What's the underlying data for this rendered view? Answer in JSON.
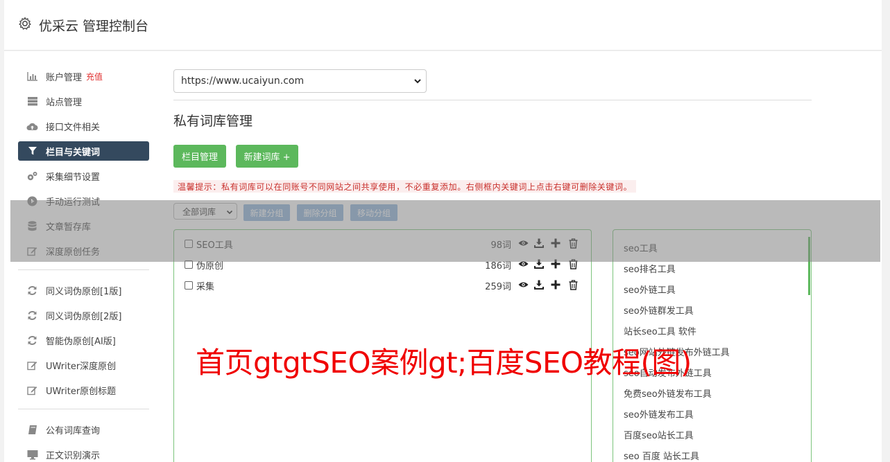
{
  "header": {
    "title": "优采云 管理控制台"
  },
  "sidebar": {
    "items": [
      {
        "label": "账户管理",
        "badge": "充值",
        "icon": "bar-chart-icon"
      },
      {
        "label": "站点管理",
        "icon": "server-icon"
      },
      {
        "label": "接口文件相关",
        "icon": "cloud-upload-icon"
      },
      {
        "label": "栏目与关键词",
        "icon": "filter-icon"
      },
      {
        "label": "采集细节设置",
        "icon": "gears-icon"
      },
      {
        "label": "手动运行测试",
        "icon": "play-circle-icon"
      },
      {
        "label": "文章暂存库",
        "icon": "database-icon"
      },
      {
        "label": "深度原创任务",
        "icon": "edit-icon"
      },
      {
        "label": "同义词伪原创[1版]",
        "icon": "refresh-icon"
      },
      {
        "label": "同义词伪原创[2版]",
        "icon": "refresh-icon"
      },
      {
        "label": "智能伪原创[AI版]",
        "icon": "refresh-icon"
      },
      {
        "label": "UWriter深度原创",
        "icon": "edit-icon"
      },
      {
        "label": "UWriter原创标题",
        "icon": "edit-icon"
      },
      {
        "label": "公有词库查询",
        "icon": "book-icon"
      },
      {
        "label": "正文识别演示",
        "icon": "monitor-icon"
      }
    ],
    "active_index": 3
  },
  "site_select": {
    "value": "https://www.ucaiyun.com"
  },
  "page_title": "私有词库管理",
  "buttons": {
    "column_manage": "栏目管理",
    "new_library": "新建词库 +"
  },
  "tip": "温馨提示：私有词库可以在同账号不同网站之间共享使用，不必重复添加。右侧框内关键词上点击右键可删除关键词。",
  "filter": {
    "select_value": "全部词库",
    "new_group": "新建分组",
    "delete_group": "删除分组",
    "move_group": "移动分组"
  },
  "libraries": [
    {
      "name": "SEO工具",
      "count": "98词"
    },
    {
      "name": "伪原创",
      "count": "186词"
    },
    {
      "name": "采集",
      "count": "259词"
    }
  ],
  "keywords": [
    "seo工具",
    "seo排名工具",
    "seo外链工具",
    "seo外链群发工具",
    "站长seo工具 软件",
    "seo网站外链发布外链工具",
    "seo自动发布外链工具",
    "免费seo外链发布工具",
    "seo外链发布工具",
    "百度seo站长工具",
    "seo 百度 站长工具"
  ],
  "watermark": "首页gtgtSEO案例gt;百度SEO教程(图)",
  "colors": {
    "green": "#5cb85c",
    "nav_active": "#34495e",
    "muted_blue": "#8fb3dc",
    "watermark_red": "#f00000"
  }
}
